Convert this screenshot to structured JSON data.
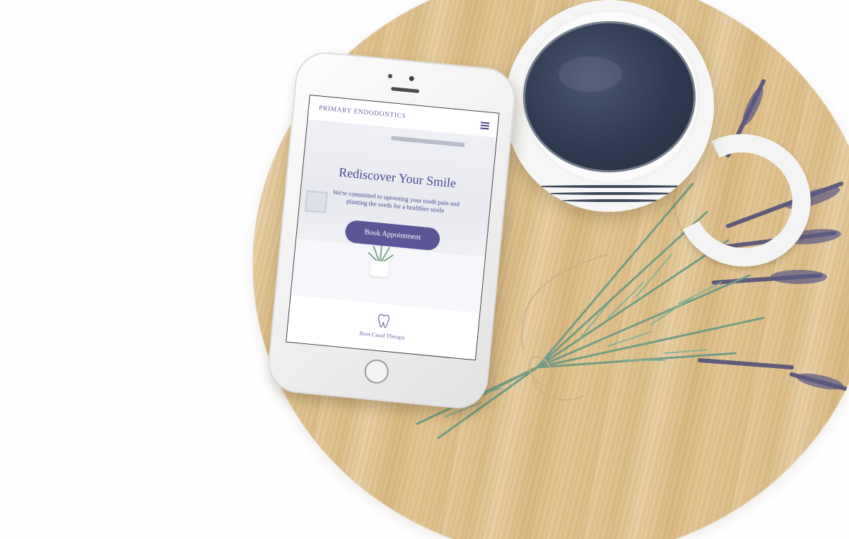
{
  "phone_screen": {
    "brand": "PRIMARY ENDODONTICS",
    "hero": {
      "title": "Rediscover Your Smile",
      "text": "We're committed to uprooting your tooth pain and planting the seeds for a healthier smile",
      "button_label": "Book Appointment"
    },
    "service": {
      "label": "Root Canal Therapy"
    }
  },
  "colors": {
    "accent": "#5c5596",
    "text_purple": "#4f4790",
    "wood": "#e2c391",
    "coffee": "#2f3a50"
  },
  "icons": [
    "menu-icon",
    "tooth-icon"
  ]
}
